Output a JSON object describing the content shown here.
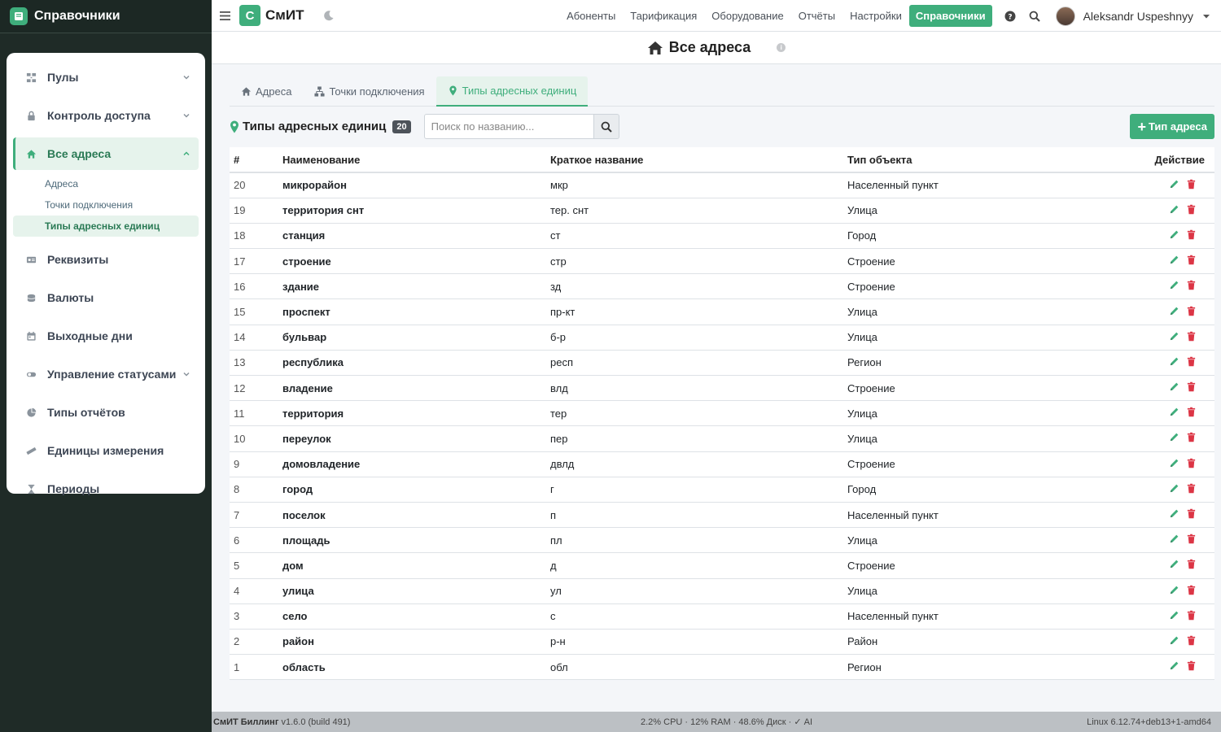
{
  "sidebar": {
    "brand": "Справочники",
    "items": [
      {
        "label": "Пулы",
        "has_chevron": true
      },
      {
        "label": "Контроль доступа",
        "has_chevron": true
      },
      {
        "label": "Все адреса",
        "has_chevron": true,
        "active": true,
        "sub": [
          "Адреса",
          "Точки подключения",
          "Типы адресных единиц"
        ]
      },
      {
        "label": "Реквизиты"
      },
      {
        "label": "Валюты"
      },
      {
        "label": "Выходные дни"
      },
      {
        "label": "Управление статусами",
        "has_chevron": true
      },
      {
        "label": "Типы отчётов"
      },
      {
        "label": "Единицы измерения"
      },
      {
        "label": "Периоды"
      }
    ]
  },
  "topbar": {
    "logo_letter": "С",
    "app_name": "СмИТ",
    "nav": [
      "Абоненты",
      "Тарификация",
      "Оборудование",
      "Отчёты",
      "Настройки"
    ],
    "active_nav": "Справочники",
    "user": "Aleksandr Uspeshnyy"
  },
  "page": {
    "title": "Все адреса"
  },
  "tabs": [
    "Адреса",
    "Точки подключения",
    "Типы адресных единиц"
  ],
  "toolbar": {
    "title": "Типы адресных единиц",
    "count": "20",
    "search_placeholder": "Поиск по названию...",
    "add_label": "Тип адреса"
  },
  "table": {
    "headers": [
      "#",
      "Наименование",
      "Краткое название",
      "Тип объекта",
      "Действие"
    ],
    "rows": [
      [
        "20",
        "микрорайон",
        "мкр",
        "Населенный пункт"
      ],
      [
        "19",
        "территория снт",
        "тер. снт",
        "Улица"
      ],
      [
        "18",
        "станция",
        "ст",
        "Город"
      ],
      [
        "17",
        "строение",
        "стр",
        "Строение"
      ],
      [
        "16",
        "здание",
        "зд",
        "Строение"
      ],
      [
        "15",
        "проспект",
        "пр-кт",
        "Улица"
      ],
      [
        "14",
        "бульвар",
        "б-р",
        "Улица"
      ],
      [
        "13",
        "республика",
        "респ",
        "Регион"
      ],
      [
        "12",
        "владение",
        "влд",
        "Строение"
      ],
      [
        "11",
        "территория",
        "тер",
        "Улица"
      ],
      [
        "10",
        "переулок",
        "пер",
        "Улица"
      ],
      [
        "9",
        "домовладение",
        "двлд",
        "Строение"
      ],
      [
        "8",
        "город",
        "г",
        "Город"
      ],
      [
        "7",
        "поселок",
        "п",
        "Населенный пункт"
      ],
      [
        "6",
        "площадь",
        "пл",
        "Улица"
      ],
      [
        "5",
        "дом",
        "д",
        "Строение"
      ],
      [
        "4",
        "улица",
        "ул",
        "Улица"
      ],
      [
        "3",
        "село",
        "с",
        "Населенный пункт"
      ],
      [
        "2",
        "район",
        "р-н",
        "Район"
      ],
      [
        "1",
        "область",
        "обл",
        "Регион"
      ]
    ]
  },
  "footer": {
    "app": "СмИТ Биллинг",
    "version": "v1.6.0 (build 491)",
    "stats": "2.2% CPU · 12% RAM · 48.6% Диск · ✓ AI",
    "os": "Linux 6.12.74+deb13+1-amd64"
  },
  "colors": {
    "accent": "#3fae7c",
    "sidebar_bg": "#1f2b27",
    "delete": "#dc3545"
  }
}
